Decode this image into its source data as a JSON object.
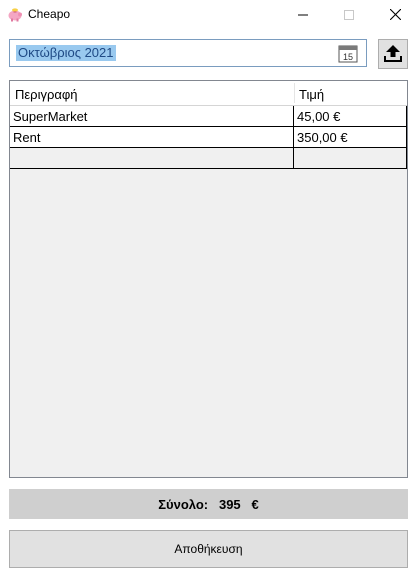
{
  "window": {
    "title": "Cheapo",
    "app_icon": "piggy-bank-icon",
    "controls": [
      "minimize-icon",
      "maximize-icon",
      "close-icon"
    ]
  },
  "date_picker": {
    "value": "Οκτώβριος 2021",
    "calendar_icon_text": "15",
    "selection_color": "#99c9ef"
  },
  "upload_button": {
    "icon": "upload-icon"
  },
  "table": {
    "columns": [
      "Περιγραφή",
      "Τιμή"
    ],
    "rows": [
      {
        "description": "SuperMarket",
        "price": "45,00 €"
      },
      {
        "description": "Rent",
        "price": "350,00 €"
      }
    ]
  },
  "total": {
    "label": "Σύνολο:",
    "value": "395",
    "currency": "€"
  },
  "save_button": {
    "label": "Αποθήκευση"
  }
}
